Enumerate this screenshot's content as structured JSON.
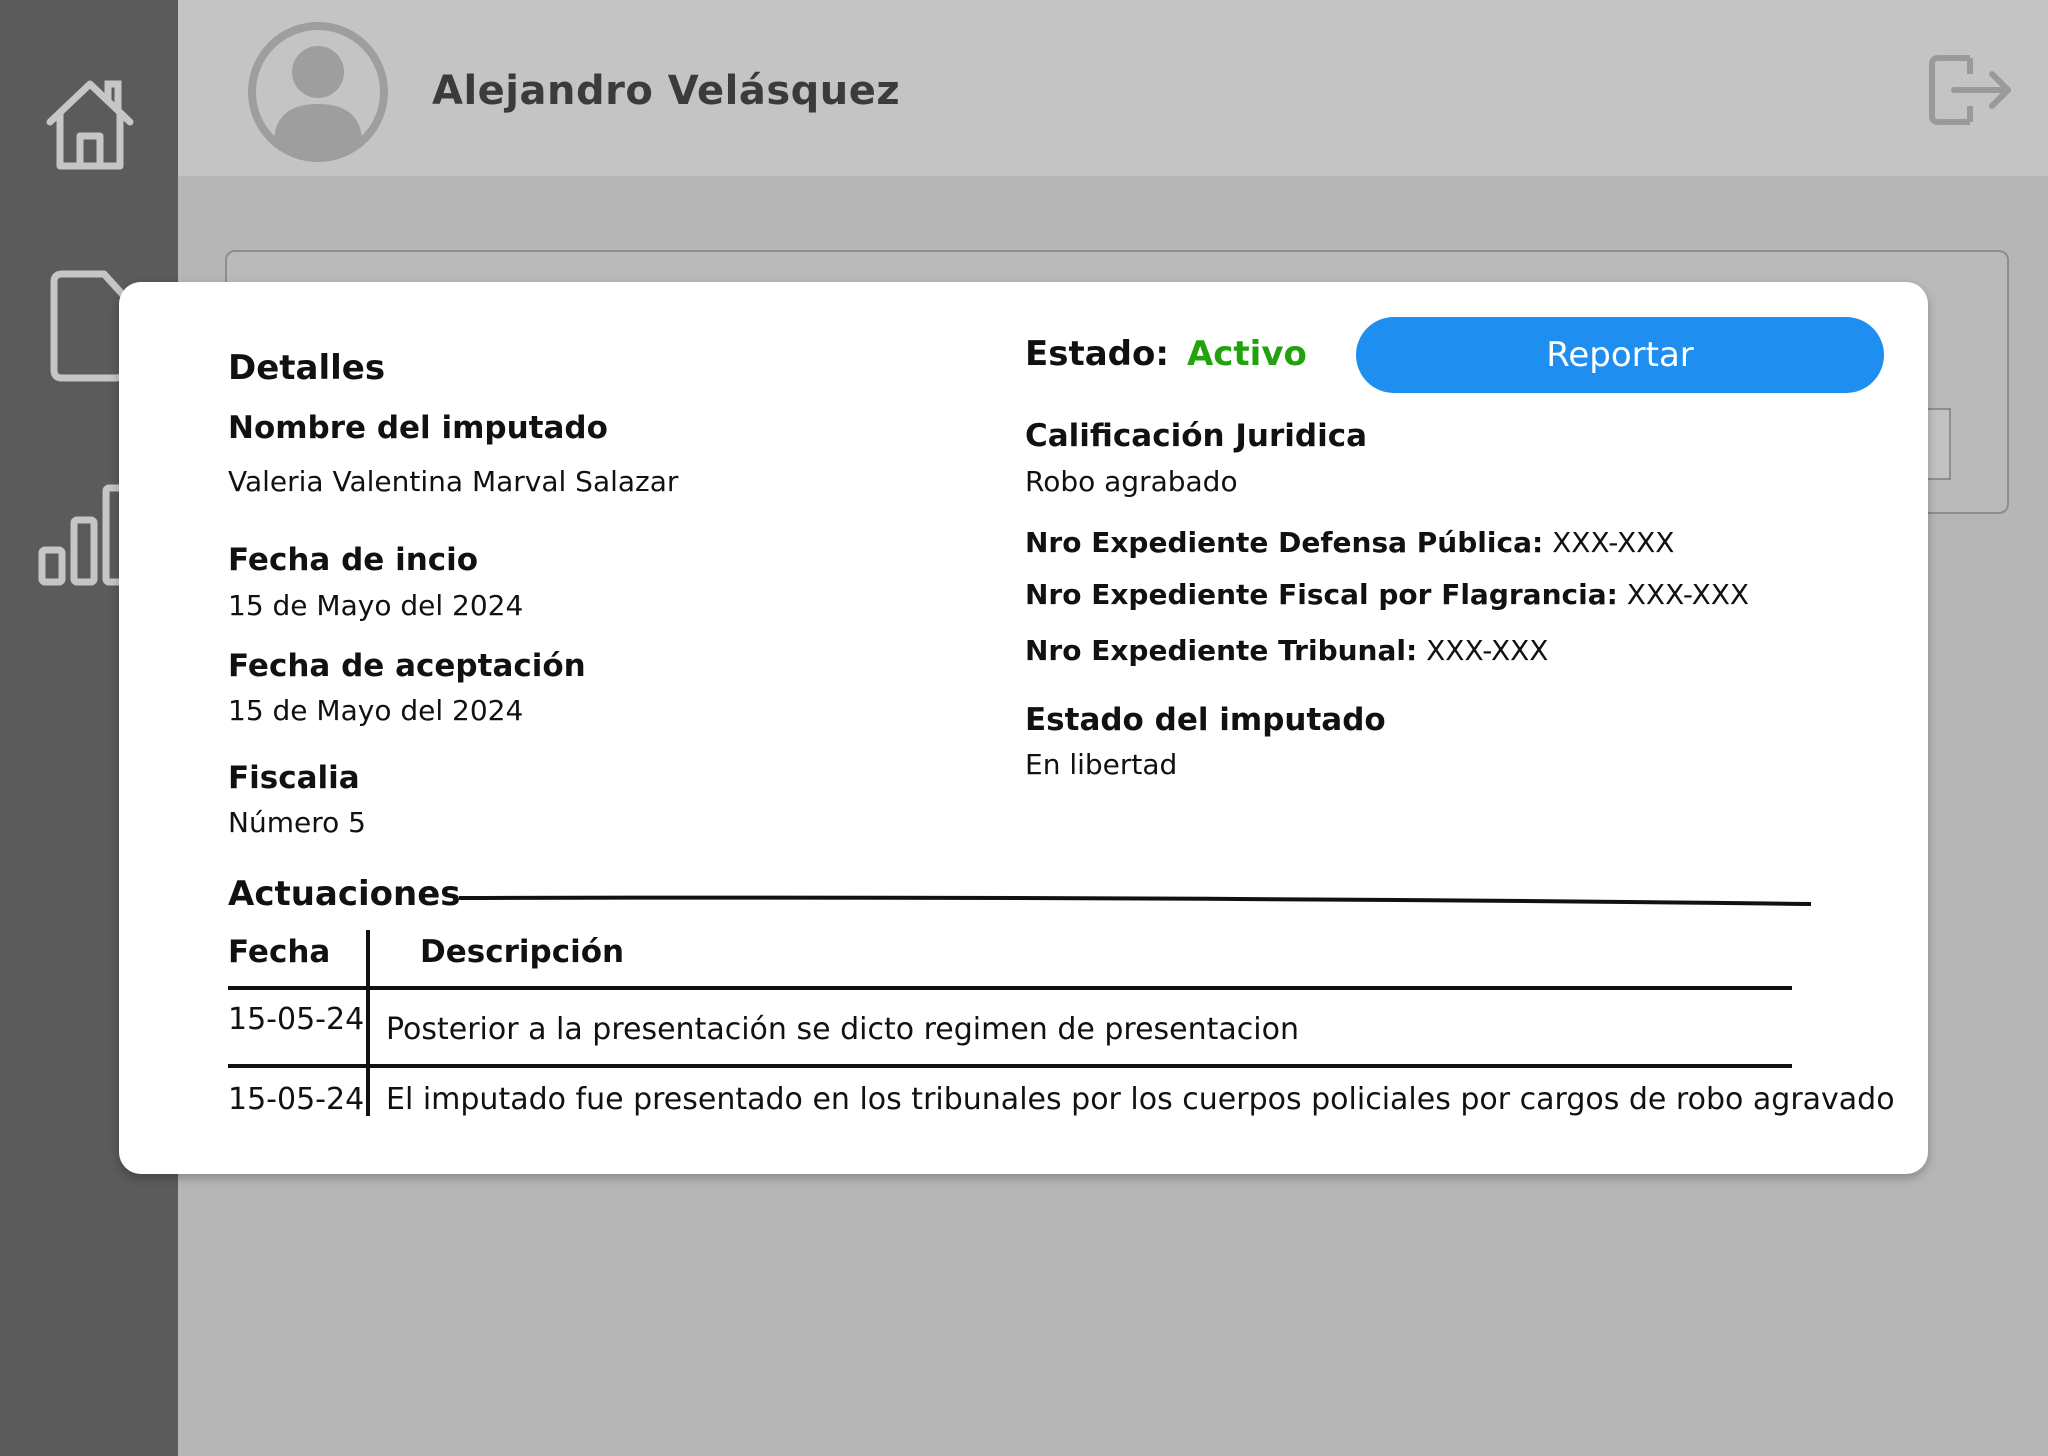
{
  "header": {
    "user_name": "Alejandro Velásquez"
  },
  "sidebar": {
    "items": [
      {
        "icon": "home-icon"
      },
      {
        "icon": "document-icon"
      },
      {
        "icon": "bar-chart-icon"
      }
    ]
  },
  "modal": {
    "details_title": "Detalles",
    "nombre_label": "Nombre del imputado",
    "nombre_value": "Valeria Valentina Marval Salazar",
    "fecha_inicio_label": "Fecha de incio",
    "fecha_inicio_value": "15 de Mayo del 2024",
    "fecha_aceptacion_label": "Fecha de aceptación",
    "fecha_aceptacion_value": "15 de Mayo del 2024",
    "fiscalia_label": "Fiscalia",
    "fiscalia_value": "Número 5",
    "estado_label": "Estado:",
    "estado_value": "Activo",
    "reportar_label": "Reportar",
    "calificacion_label": "Calificación Juridica",
    "calificacion_value": "Robo agrabado",
    "exp_defensa_label": "Nro Expediente Defensa Pública:",
    "exp_defensa_value": "XXX-XXX",
    "exp_fiscal_label": "Nro Expediente Fiscal por Flagrancia:",
    "exp_fiscal_value": "XXX-XXX",
    "exp_tribunal_label": "Nro Expediente Tribunal:",
    "exp_tribunal_value": "XXX-XXX",
    "estado_imputado_label": "Estado del imputado",
    "estado_imputado_value": "En libertad",
    "actuaciones_title": "Actuaciones",
    "table": {
      "headers": [
        "Fecha",
        "Descripción"
      ],
      "rows": [
        {
          "fecha": "15-05-24",
          "descripcion": "Posterior a la presentación se dicto regimen de presentacion"
        },
        {
          "fecha": "15-05-24",
          "descripcion": "El imputado fue presentado en los tribunales por los cuerpos policiales por cargos de robo agravado"
        }
      ]
    }
  },
  "colors": {
    "sidebar": "#5b5b5b",
    "topbar": "#c4c4c4",
    "backdrop": "#b6b6b6",
    "accent": "#1f8ef1",
    "status_active": "#22a30e"
  }
}
